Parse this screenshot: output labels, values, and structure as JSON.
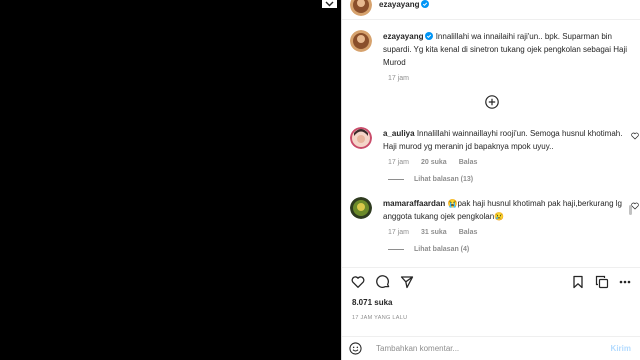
{
  "post": {
    "username": "ezayayang",
    "caption_user": "ezayayang",
    "caption_text": "Innalillahi wa innailaihi raji'un.. bpk. Suparman bin supardi. Yg kita kenal di sinetron tukang ojek pengkolan sebagai Haji Murod",
    "caption_time": "17 jam"
  },
  "comments": [
    {
      "user": "a_auliya",
      "text": "Innalillahi wainnaillayhi rooji'un. Semoga husnul khotimah. Haji murod yg meranin jd bapaknya mpok uyuy..",
      "time": "17 jam",
      "likes": "20 suka",
      "reply": "Balas",
      "view_replies": "Lihat balasan (13)"
    },
    {
      "user": "mamaraffaardan",
      "text": "😭pak haji husnul khotimah pak haji,berkurang lg anggota tukang ojek pengkolan😢",
      "time": "17 jam",
      "likes": "31 suka",
      "reply": "Balas",
      "view_replies": "Lihat balasan (4)"
    }
  ],
  "likes_count": "8.071 suka",
  "time_ago": "17 JAM YANG LALU",
  "add_comment": {
    "placeholder": "Tambahkan komentar...",
    "post_label": "Kirim"
  },
  "icons": [
    "chevron-down-icon",
    "verified-icon",
    "plus-circle-icon",
    "heart-icon",
    "comment-icon",
    "share-icon",
    "save-icon",
    "emoji-icon"
  ],
  "colors": {
    "verified": "#0095f6",
    "post_disabled": "#b3dbff",
    "muted": "#8e8e8e"
  }
}
